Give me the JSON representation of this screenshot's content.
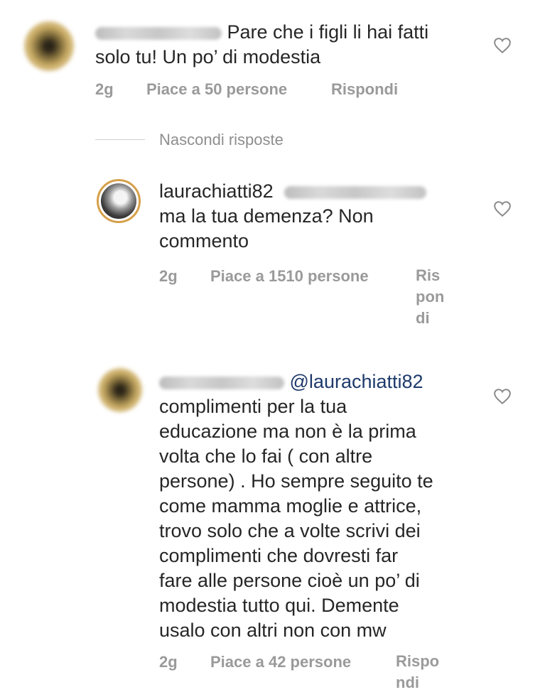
{
  "comments": [
    {
      "username": "",
      "text_line1": "Pare che i figli li hai fatti",
      "text_line2": "solo tu! Un po’ di modestia",
      "time": "2g",
      "likes": "Piace a 50 persone",
      "reply": "Rispondi"
    },
    {
      "username": "laurachiatti82",
      "text_line1": "ma la tua demenza? Non",
      "text_line2": "commento",
      "time": "2g",
      "likes": "Piace a 1510 persone",
      "reply_lines": [
        "Ris",
        "pon",
        "di"
      ]
    },
    {
      "username": "",
      "mention": "@laurachiatti82",
      "lines": [
        "complimenti per la tua",
        "educazione ma non è la prima",
        "volta che lo fai ( con altre",
        "persone) . Ho sempre seguito te",
        "come mamma moglie e attrice,",
        "trovo solo che a volte scrivi dei",
        "complimenti che dovresti far",
        "fare alle persone cioè un po’ di",
        "modestia tutto qui. Demente",
        "usalo con altri non con mw"
      ],
      "time": "2g",
      "likes": "Piace a 42 persone",
      "reply_lines": [
        "Rispo",
        "ndi"
      ]
    }
  ],
  "hide_replies": "Nascondi risposte",
  "icons": {
    "like": "heart-outline-icon"
  },
  "colors": {
    "story_ring": "#d6a04a",
    "mention": "#1e3a6b",
    "meta": "#9a9a9a"
  }
}
